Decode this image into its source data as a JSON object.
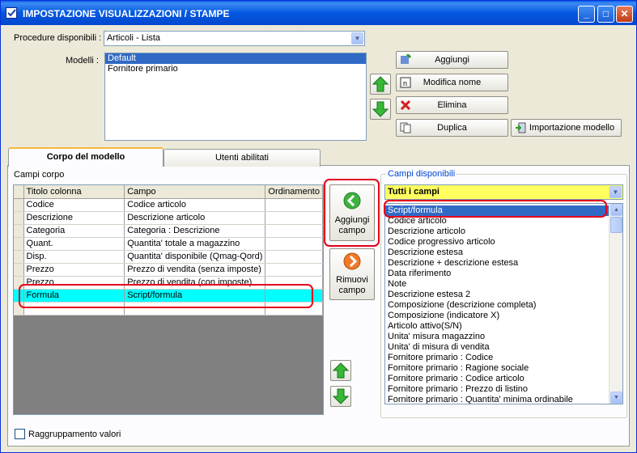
{
  "window": {
    "title": "IMPOSTAZIONE VISUALIZZAZIONI / STAMPE",
    "controls": {
      "minimize": "_",
      "maximize": "□",
      "close": "✕"
    }
  },
  "procedure": {
    "label": "Procedure disponibili :",
    "selected": "Articoli - Lista"
  },
  "models": {
    "label": "Modelli :",
    "items": [
      "Default",
      "Fornitore primario"
    ],
    "selected_index": 0
  },
  "model_buttons": {
    "add": "Aggiungi",
    "rename": "Modifica nome",
    "delete": "Elimina",
    "duplicate": "Duplica",
    "import": "Importazione modello"
  },
  "tabs": [
    "Corpo del modello",
    "Utenti abilitati"
  ],
  "body_fields": {
    "label": "Campi corpo",
    "columns": [
      "Titolo colonna",
      "Campo",
      "Ordinamento"
    ],
    "rows": [
      [
        "Codice",
        "Codice articolo",
        ""
      ],
      [
        "Descrizione",
        "Descrizione articolo",
        ""
      ],
      [
        "Categoria",
        "Categoria : Descrizione",
        ""
      ],
      [
        "Quant.",
        "Quantita' totale a magazzino",
        ""
      ],
      [
        "Disp.",
        "Quantita' disponibile (Qmag-Qord)",
        ""
      ],
      [
        "Prezzo",
        "Prezzo di vendita (senza imposte)",
        ""
      ],
      [
        "Prezzo",
        "Prezzo di vendita (con imposte)",
        ""
      ],
      [
        "Formula",
        "Script/formula",
        ""
      ]
    ],
    "highlighted_row": 7
  },
  "middle_buttons": {
    "add_field": "Aggiungi campo",
    "remove_field": "Rimuovi campo"
  },
  "available_fields": {
    "label": "Campi disponibili",
    "filter": "Tutti i campi",
    "items": [
      "Script/formula",
      "Codice articolo",
      "Descrizione articolo",
      "Codice progressivo articolo",
      "Descrizione estesa",
      "Descrizione + descrizione estesa",
      "Data riferimento",
      "Note",
      "Descrizione estesa 2",
      "Composizione (descrizione completa)",
      "Composizione (indicatore X)",
      "Articolo attivo(S/N)",
      "Unita' misura magazzino",
      "Unita' di misura di vendita",
      "Fornitore primario : Codice",
      "Fornitore primario : Ragione sociale",
      "Fornitore primario : Codice articolo",
      "Fornitore primario : Prezzo di listino",
      "Fornitore primario : Quantita' minima ordinabile"
    ],
    "selected_index": 0
  },
  "grouping": {
    "label": "Raggruppamento valori",
    "checked": false
  },
  "colors": {
    "title_bar": "#0458e0",
    "selection": "#316ac5",
    "highlight_row": "#00ffff",
    "filter_bg": "#ffff60",
    "annotation": "#e3001b"
  }
}
